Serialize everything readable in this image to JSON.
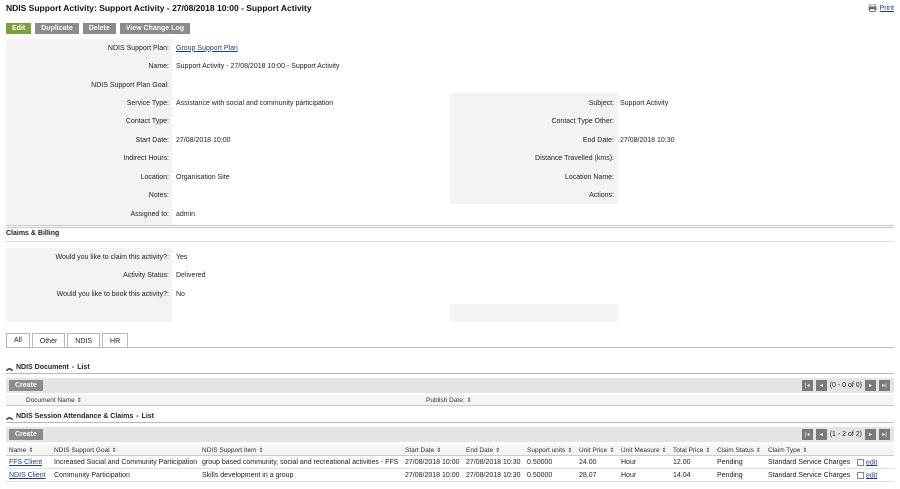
{
  "header": {
    "title": "NDIS Support Activity: Support Activity - 27/08/2018 10:00 - Support Activity",
    "print_label": "Print"
  },
  "toolbar": {
    "edit": "Edit",
    "duplicate": "Duplicate",
    "delete": "Delete",
    "view_change_log": "View Change Log"
  },
  "details": {
    "plan_label": "NDIS Support Plan:",
    "plan_value": "Group Support Plan",
    "name_label": "Name:",
    "name_value": "Support Activity - 27/08/2018 10:00 - Support Activity",
    "goal_label": "NDIS Support Plan Goal:",
    "service_type_label": "Service Type:",
    "service_type_value": "Assistance with social and community participation",
    "subject_label": "Subject:",
    "subject_value": "Support Activity",
    "contact_type_label": "Contact Type:",
    "contact_type_other_label": "Contact Type Other:",
    "start_date_label": "Start Date:",
    "start_date_value": "27/08/2018 10:00",
    "end_date_label": "End Date:",
    "end_date_value": "27/08/2018 10:30",
    "indirect_hours_label": "Indirect Hours:",
    "distance_label": "Distance Travelled (kms):",
    "location_label": "Location:",
    "location_value": "Organisation Site",
    "location_name_label": "Location Name:",
    "notes_label": "Notes:",
    "actions_label": "Actions:",
    "assigned_label": "Assigned to:",
    "assigned_value": "admin"
  },
  "claims": {
    "heading": "Claims & Billing",
    "claim_q_label": "Would you like to claim this activity?:",
    "claim_q_value": "Yes",
    "status_label": "Activity Status:",
    "status_value": "Delivered",
    "book_q_label": "Would you like to book this activity?:",
    "book_q_value": "No"
  },
  "tabs": [
    "All",
    "Other",
    "NDIS",
    "HR"
  ],
  "doc_panel": {
    "title": "NDIS Document",
    "sub": "List",
    "create": "Create",
    "pager_text": "(0 - 0 of 0)",
    "columns": [
      "Document Name",
      "Publish Date:"
    ]
  },
  "session_panel": {
    "title": "NDIS Session Attendance & Claims",
    "sub": "List",
    "create": "Create",
    "pager_text": "(1 - 2 of 2)",
    "columns": [
      "Name",
      "NDIS Support Goal",
      "NDIS Support Item",
      "Start Date",
      "End Date",
      "Support units",
      "Unit Price",
      "Unit Measure",
      "Total Price",
      "Claim Status",
      "Claim Type"
    ],
    "rows": [
      [
        "FFS Client",
        "Increased Social and Community Participation",
        "group based community, social and recreational activities - FFS",
        "27/08/2018 10:00",
        "27/08/2018 10:30",
        "0.50000",
        "24.00",
        "Hour",
        "12.00",
        "Pending",
        "Standard Service Charges",
        "edit"
      ],
      [
        "NDIS Client",
        "Community Participation",
        "Skills development in a group",
        "27/08/2018 10:00",
        "27/08/2018 10:30",
        "0.50000",
        "28.07",
        "Hour",
        "14.04",
        "Pending",
        "Standard Service Charges",
        "edit"
      ]
    ]
  },
  "colors": {
    "edit_button": "#7aa23a",
    "grey_button": "#8b8b8b",
    "link": "#1a3f8f",
    "panel_bg": "#f3f3f3"
  },
  "icons": {
    "print": "printer-icon",
    "collapse": "double-chevron-up-icon",
    "sort": "sort-icon",
    "edit": "edit-icon"
  }
}
